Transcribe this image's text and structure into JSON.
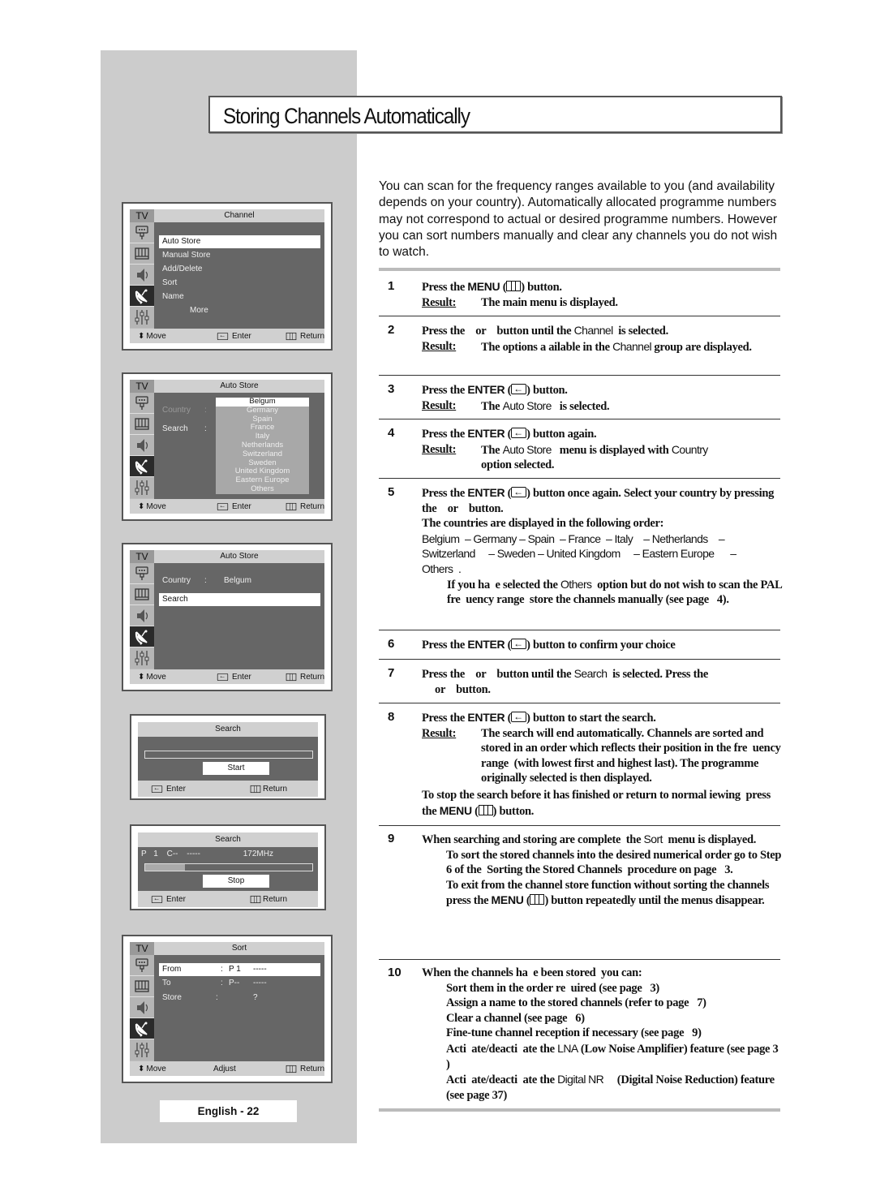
{
  "page": {
    "title": "Storing Channels Automatically",
    "page_number": "English - 22"
  },
  "osd_common": {
    "tv_label": "TV",
    "move_label": "Move",
    "enter_label": "Enter",
    "return_label": "Return",
    "adjust_label": "Adjust",
    "sidebar_icons": [
      "picture-icon",
      "sound-equalizer-icon",
      "speaker-icon",
      "channel-antenna-icon",
      "setup-sliders-icon"
    ],
    "active_icon": "channel-antenna-icon"
  },
  "osd_channel": {
    "title": "Channel",
    "items": [
      "Auto Store",
      "Manual Store",
      "Add/Delete",
      "Sort",
      "Name",
      "More"
    ],
    "selected": "Auto Store"
  },
  "osd_autostore_dropdown": {
    "title": "Auto Store",
    "country_label": "Country",
    "search_label": "Search",
    "separator": ":",
    "countries": [
      "Belgum",
      "Germany",
      "Spain",
      "France",
      "Italy",
      "Netherlands",
      "Switzerland",
      "Sweden",
      "United Kingdom",
      "Eastern Europe",
      "Others"
    ],
    "selected_country": "Belgum"
  },
  "osd_autostore": {
    "title": "Auto Store",
    "country_label": "Country",
    "separator": ":",
    "country_value": "Belgum",
    "search_label": "Search",
    "selected": "Search"
  },
  "osd_search_start": {
    "title": "Search",
    "button": "Start",
    "progress": 0
  },
  "osd_search_running": {
    "title": "Search",
    "prog_label": "P",
    "prog_num": "1",
    "channel": "C--",
    "name": "-----",
    "frequency": "172MHz",
    "button": "Stop",
    "progress": 0.24
  },
  "osd_sort": {
    "title": "Sort",
    "rows": [
      {
        "label": "From",
        "sep": ":",
        "value": "P 1",
        "extra": "-----"
      },
      {
        "label": "To",
        "sep": ":",
        "value": "P--",
        "extra": "-----"
      },
      {
        "label": "Store",
        "sep": ":",
        "value": "",
        "extra": "?"
      }
    ],
    "selected": "From"
  },
  "intro": "You can scan for the frequency ranges available to you (and availability depends on your country). Automatically allocated programme numbers may not correspond to actual or desired programme numbers. However you can sort numbers manually and clear any channels you do not wish to watch.",
  "result_label": "Result:",
  "steps": {
    "s1": {
      "num": "1",
      "a": "Press the ",
      "key": "MENU",
      "b": " button.",
      "result": "The main menu is displayed."
    },
    "s2": {
      "num": "2",
      "a": "Press the    or    button until the ",
      "opt": "Channel",
      "b": "  is selected.",
      "result_a": "The options a  ailable in the ",
      "result_opt": "Channel",
      "result_b": "  group are displayed."
    },
    "s3": {
      "num": "3",
      "a": "Press the ",
      "key": "ENTER",
      "b": " button.",
      "result_a": "The ",
      "result_opt": "Auto Store",
      "result_b": "   is selected."
    },
    "s4": {
      "num": "4",
      "a": "Press the ",
      "key": "ENTER",
      "b": " button again.",
      "result_a": "The ",
      "result_opt": "Auto Store",
      "result_b": "   menu is displayed with ",
      "result_opt2": "Country",
      "result_c": "option selected."
    },
    "s5": {
      "num": "5",
      "a": "Press the ",
      "key": "ENTER",
      "b": " button once again. Select your country by pressing the    or    button.",
      "c": "The countries are displayed in the following order:",
      "countries_1": "Belgium  – Germany – Spain  – France  – Italy    – Netherlands    –",
      "countries_2": "Switzerland     – Sweden – United Kingdom     – Eastern Europe      –",
      "countries_3": "Others  .",
      "note_a": "If you ha  e selected the ",
      "note_opt": "Others",
      "note_b": "  option but do not wish to scan the PAL fre  uency range  store the channels manually (see page   4)."
    },
    "s6": {
      "num": "6",
      "a": "Press the ",
      "key": "ENTER",
      "b": " button to confirm your choice"
    },
    "s7": {
      "num": "7",
      "a": "Press the    or    button until the ",
      "opt": "Search",
      "b": "  is selected. Press the",
      "c": "or    button."
    },
    "s8": {
      "num": "8",
      "a": "Press the ",
      "key": "ENTER",
      "b": " button to start the search.",
      "result": "The search will end automatically. Channels are sorted and stored in an order which reflects their position in the fre  uency range  (with lowest first and highest last). The programme originally selected is then displayed.",
      "note_a": "To stop the search before it has finished or return to normal iewing  press the ",
      "note_key": "MENU",
      "note_b": " button."
    },
    "s9": {
      "num": "9",
      "a": "When searching and storing are complete  the ",
      "opt": "Sort",
      "b": "  menu is displayed.",
      "note1": "To sort the stored channels into the desired numerical order go to Step 6 of the  Sorting the Stored Channels  procedure on page   3.",
      "note2_a": "To exit from the channel store function without sorting the channels  press the ",
      "note2_key": "MENU",
      "note2_b": " button repeatedly until the menus disappear."
    },
    "s10": {
      "num": "10",
      "a": "When the channels ha  e been stored  you can:",
      "items": [
        "Sort them in the order re  uired (see page   3)",
        "Assign a name to the stored channels (refer to page   7)",
        "Clear a channel (see page   6)",
        "Fine-tune channel reception if necessary (see page   9)"
      ],
      "lna_a": "Acti  ate/deacti  ate the ",
      "lna_opt": "LNA",
      "lna_b": " (Low Noise Amplifier) feature (see page 3  )",
      "dnr_a": "Acti  ate/deacti  ate the ",
      "dnr_opt": "Digital NR",
      "dnr_b": "     (Digital Noise Reduction) feature (see page 37)"
    }
  }
}
